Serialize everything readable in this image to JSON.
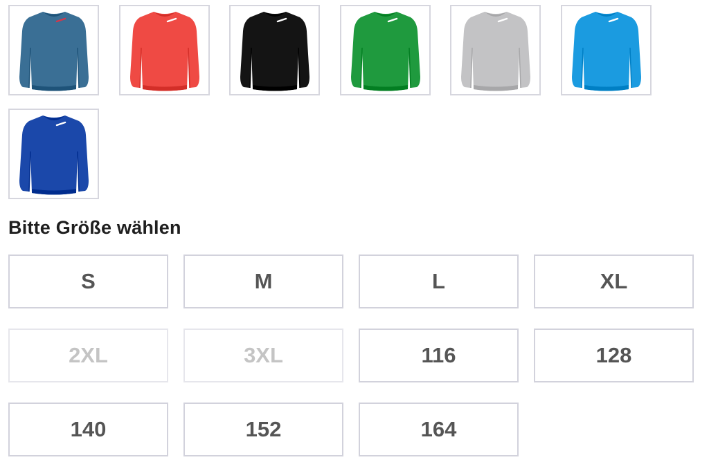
{
  "colors": [
    {
      "name": "petrol",
      "hex": "#3a6f95",
      "logo": "#d2384c"
    },
    {
      "name": "red",
      "hex": "#ef4a44",
      "logo": "#ffffff"
    },
    {
      "name": "black",
      "hex": "#141414",
      "logo": "#ffffff"
    },
    {
      "name": "green",
      "hex": "#1f9a3e",
      "logo": "#ffffff"
    },
    {
      "name": "grey",
      "hex": "#c3c3c5",
      "logo": "#ffffff"
    },
    {
      "name": "azure",
      "hex": "#1b9be0",
      "logo": "#ffffff"
    },
    {
      "name": "royal",
      "hex": "#1b48aa",
      "logo": "#ffffff"
    }
  ],
  "size_section": {
    "heading": "Bitte Größe wählen",
    "sizes": [
      {
        "label": "S",
        "available": true
      },
      {
        "label": "M",
        "available": true
      },
      {
        "label": "L",
        "available": true
      },
      {
        "label": "XL",
        "available": true
      },
      {
        "label": "2XL",
        "available": false
      },
      {
        "label": "3XL",
        "available": false
      },
      {
        "label": "116",
        "available": true
      },
      {
        "label": "128",
        "available": true
      },
      {
        "label": "140",
        "available": true
      },
      {
        "label": "152",
        "available": true
      },
      {
        "label": "164",
        "available": true
      }
    ]
  }
}
